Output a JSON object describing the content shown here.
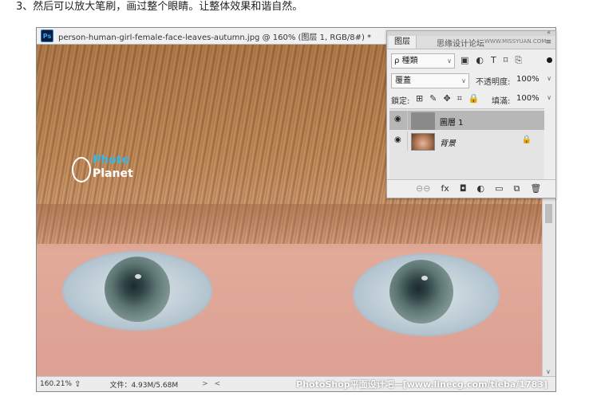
{
  "caption": "3、然后可以放大笔刷，画过整个眼睛。让整体效果和谐自然。",
  "document": {
    "app_icon": "Ps",
    "title": "person-human-girl-female-face-leaves-autumn.jpg @ 160% (图层 1, RGB/8#) *"
  },
  "canvas_watermark": {
    "line1": "Photo",
    "line2": "Planet"
  },
  "status": {
    "zoom": "160.21%",
    "share_icon": "share-icon",
    "doc_info": "文件：4.93M/5.68M",
    "arrow": ">",
    "scroll_left": "<"
  },
  "footer_watermark": "PhotoShop平面设计吧—[www.linecg.com/tieba/1783]",
  "layers_panel": {
    "tab_label": "图层",
    "collapse_icon": "«",
    "site_watermark": "思缘设计论坛",
    "site_url": "WWW.MISSYUAN.COM",
    "menu_icon": "≡",
    "filter": {
      "search_glyph": "ρ",
      "label": "種類",
      "dropdown": "∨",
      "icons": [
        "▣",
        "◐",
        "T",
        "⌑",
        "⎘"
      ]
    },
    "blend_mode": "覆蓋",
    "blend_dropdown": "∨",
    "opacity_label": "不透明度:",
    "opacity_value": "100%",
    "opacity_dropdown": "∨",
    "lock_label": "鎖定:",
    "lock_icons": [
      "⊞",
      "✎",
      "✥",
      "⌗",
      "🔒"
    ],
    "fill_label": "填滿:",
    "fill_value": "100%",
    "fill_dropdown": "∨",
    "layers": [
      {
        "name": "圖層 1",
        "selected": true
      },
      {
        "name": "背景",
        "selected": false,
        "locked": true
      }
    ],
    "eye_glyph": "👁",
    "lock_glyph": "🔒",
    "footer_icons": [
      "⊖⊖",
      "fx",
      "◘",
      "◐",
      "▭",
      "⧉",
      "🗑"
    ]
  },
  "scrollbar": {
    "down_arrow": "∨"
  },
  "colors": {
    "ps_chrome": "#f0f0f0",
    "panel_bg": "#eeeeee",
    "selected_layer": "#b7b7b7",
    "watermark_blue": "#33b7ea"
  }
}
